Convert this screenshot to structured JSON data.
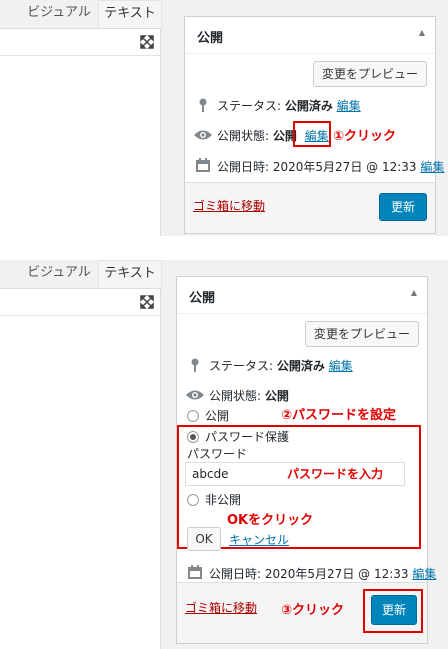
{
  "tabs": {
    "visual": "ビジュアル",
    "text": "テキスト"
  },
  "top": {
    "title": "公開",
    "preview_button": "変更をプレビュー",
    "status_label": "ステータス:",
    "status_value": "公開済み",
    "edit_link": "編集",
    "visibility_label": "公開状態:",
    "visibility_value": "公開",
    "visibility_edit": "編集",
    "annotation_1": "①クリック",
    "published_label": "公開日時:",
    "published_value": "2020年5月27日 @ 12:33",
    "published_edit": "編集",
    "trash_link": "ゴミ箱に移動",
    "update_button": "更新"
  },
  "bottom": {
    "title": "公開",
    "preview_button": "変更をプレビュー",
    "status_label": "ステータス:",
    "status_value": "公開済み",
    "edit_link": "編集",
    "visibility_label": "公開状態:",
    "visibility_value": "公開",
    "option_public": "公開",
    "option_password": "パスワード保護",
    "annotation_2": "②パスワードを設定",
    "password_label": "パスワード",
    "password_value": "abcde",
    "password_annotation": "パスワードを入力",
    "option_private": "非公開",
    "ok_annotation": "OKをクリック",
    "ok_button": "OK",
    "cancel_link": "キャンセル",
    "published_label": "公開日時:",
    "published_value": "2020年5月27日 @ 12:33",
    "published_edit": "編集",
    "trash_link": "ゴミ箱に移動",
    "annotation_3": "③クリック",
    "update_button": "更新"
  },
  "icons": {
    "fullscreen": "fullscreen-icon",
    "pin": "pin-icon",
    "eye": "eye-icon",
    "calendar": "calendar-icon",
    "toggle": "triangle-up-icon"
  },
  "colors": {
    "primary": "#0085ba",
    "link": "#0073aa",
    "danger": "#a00",
    "annotation": "#e00000"
  }
}
